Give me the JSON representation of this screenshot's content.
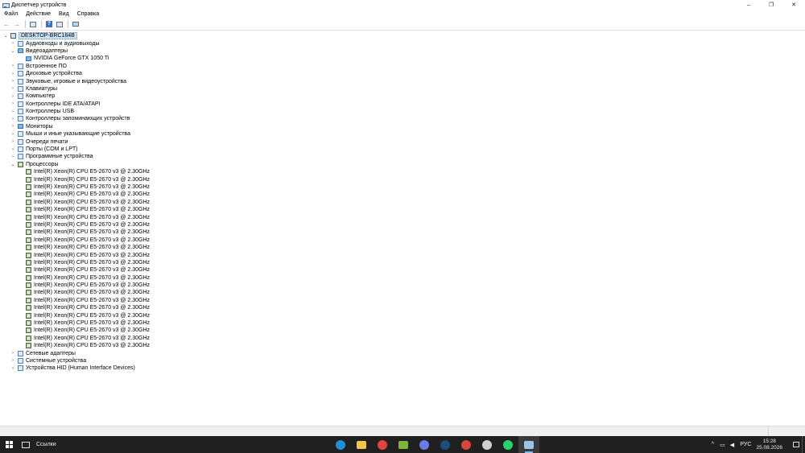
{
  "window": {
    "title": "Диспетчер устройств",
    "minimize": "–",
    "restore": "❐",
    "close": "✕"
  },
  "menu": [
    "Файл",
    "Действие",
    "Вид",
    "Справка"
  ],
  "toolbar": {
    "back": "←",
    "forward": "→",
    "help": "?"
  },
  "tree": {
    "root": "DESKTOP-BRC184B",
    "categories": [
      {
        "label": "Аудиовходы и аудиовыходы",
        "expanded": false
      },
      {
        "label": "Видеоадаптеры",
        "expanded": true,
        "children": [
          "NVIDIA GeForce GTX 1050 Ti"
        ]
      },
      {
        "label": "Встроенное ПО",
        "expanded": false
      },
      {
        "label": "Дисковые устройства",
        "expanded": false
      },
      {
        "label": "Звуковые, игровые и видеоустройства",
        "expanded": false
      },
      {
        "label": "Клавиатуры",
        "expanded": false
      },
      {
        "label": "Компьютер",
        "expanded": false
      },
      {
        "label": "Контроллеры IDE ATA/ATAPI",
        "expanded": false
      },
      {
        "label": "Контроллеры USB",
        "expanded": false
      },
      {
        "label": "Контроллеры запоминающих устройств",
        "expanded": false
      },
      {
        "label": "Мониторы",
        "expanded": false
      },
      {
        "label": "Мыши и иные указывающие устройства",
        "expanded": false
      },
      {
        "label": "Очереди печати",
        "expanded": false
      },
      {
        "label": "Порты (COM и LPT)",
        "expanded": false
      },
      {
        "label": "Программные устройства",
        "expanded": false
      },
      {
        "label": "Процессоры",
        "expanded": true,
        "children": [
          "Intel(R) Xeon(R) CPU E5-2670 v3 @ 2.30GHz",
          "Intel(R) Xeon(R) CPU E5-2670 v3 @ 2.30GHz",
          "Intel(R) Xeon(R) CPU E5-2670 v3 @ 2.30GHz",
          "Intel(R) Xeon(R) CPU E5-2670 v3 @ 2.30GHz",
          "Intel(R) Xeon(R) CPU E5-2670 v3 @ 2.30GHz",
          "Intel(R) Xeon(R) CPU E5-2670 v3 @ 2.30GHz",
          "Intel(R) Xeon(R) CPU E5-2670 v3 @ 2.30GHz",
          "Intel(R) Xeon(R) CPU E5-2670 v3 @ 2.30GHz",
          "Intel(R) Xeon(R) CPU E5-2670 v3 @ 2.30GHz",
          "Intel(R) Xeon(R) CPU E5-2670 v3 @ 2.30GHz",
          "Intel(R) Xeon(R) CPU E5-2670 v3 @ 2.30GHz",
          "Intel(R) Xeon(R) CPU E5-2670 v3 @ 2.30GHz",
          "Intel(R) Xeon(R) CPU E5-2670 v3 @ 2.30GHz",
          "Intel(R) Xeon(R) CPU E5-2670 v3 @ 2.30GHz",
          "Intel(R) Xeon(R) CPU E5-2670 v3 @ 2.30GHz",
          "Intel(R) Xeon(R) CPU E5-2670 v3 @ 2.30GHz",
          "Intel(R) Xeon(R) CPU E5-2670 v3 @ 2.30GHz",
          "Intel(R) Xeon(R) CPU E5-2670 v3 @ 2.30GHz",
          "Intel(R) Xeon(R) CPU E5-2670 v3 @ 2.30GHz",
          "Intel(R) Xeon(R) CPU E5-2670 v3 @ 2.30GHz",
          "Intel(R) Xeon(R) CPU E5-2670 v3 @ 2.30GHz",
          "Intel(R) Xeon(R) CPU E5-2670 v3 @ 2.30GHz",
          "Intel(R) Xeon(R) CPU E5-2670 v3 @ 2.30GHz",
          "Intel(R) Xeon(R) CPU E5-2670 v3 @ 2.30GHz"
        ]
      },
      {
        "label": "Сетевые адаптеры",
        "expanded": false
      },
      {
        "label": "Системные устройства",
        "expanded": false
      },
      {
        "label": "Устройства HID (Human Interface Devices)",
        "expanded": false
      }
    ]
  },
  "taskbar": {
    "links_label": "Ссылки",
    "apps": [
      {
        "icon": "edge-icon",
        "color": "#1f8fd6",
        "shape": "dot"
      },
      {
        "icon": "file-explorer-icon",
        "color": "#f2c44b",
        "shape": "sq"
      },
      {
        "icon": "chrome-icon",
        "color": "#e0443e",
        "shape": "dot"
      },
      {
        "icon": "app-green-icon",
        "color": "#7fb33a",
        "shape": "sq"
      },
      {
        "icon": "discord-icon",
        "color": "#6b78e5",
        "shape": "dot"
      },
      {
        "icon": "steam-icon",
        "color": "#1b4f7a",
        "shape": "dot"
      },
      {
        "icon": "app-colorful-icon",
        "color": "#d9453a",
        "shape": "dot"
      },
      {
        "icon": "settings-icon",
        "color": "#cfcfcf",
        "shape": "dot"
      },
      {
        "icon": "whatsapp-icon",
        "color": "#25d366",
        "shape": "dot"
      },
      {
        "icon": "device-manager-icon",
        "color": "#9ec3e6",
        "shape": "sq",
        "active": true
      }
    ],
    "tray": {
      "chevron": "^",
      "lang": "РУС",
      "time": "15:28",
      "date": "25.08.2026"
    }
  }
}
